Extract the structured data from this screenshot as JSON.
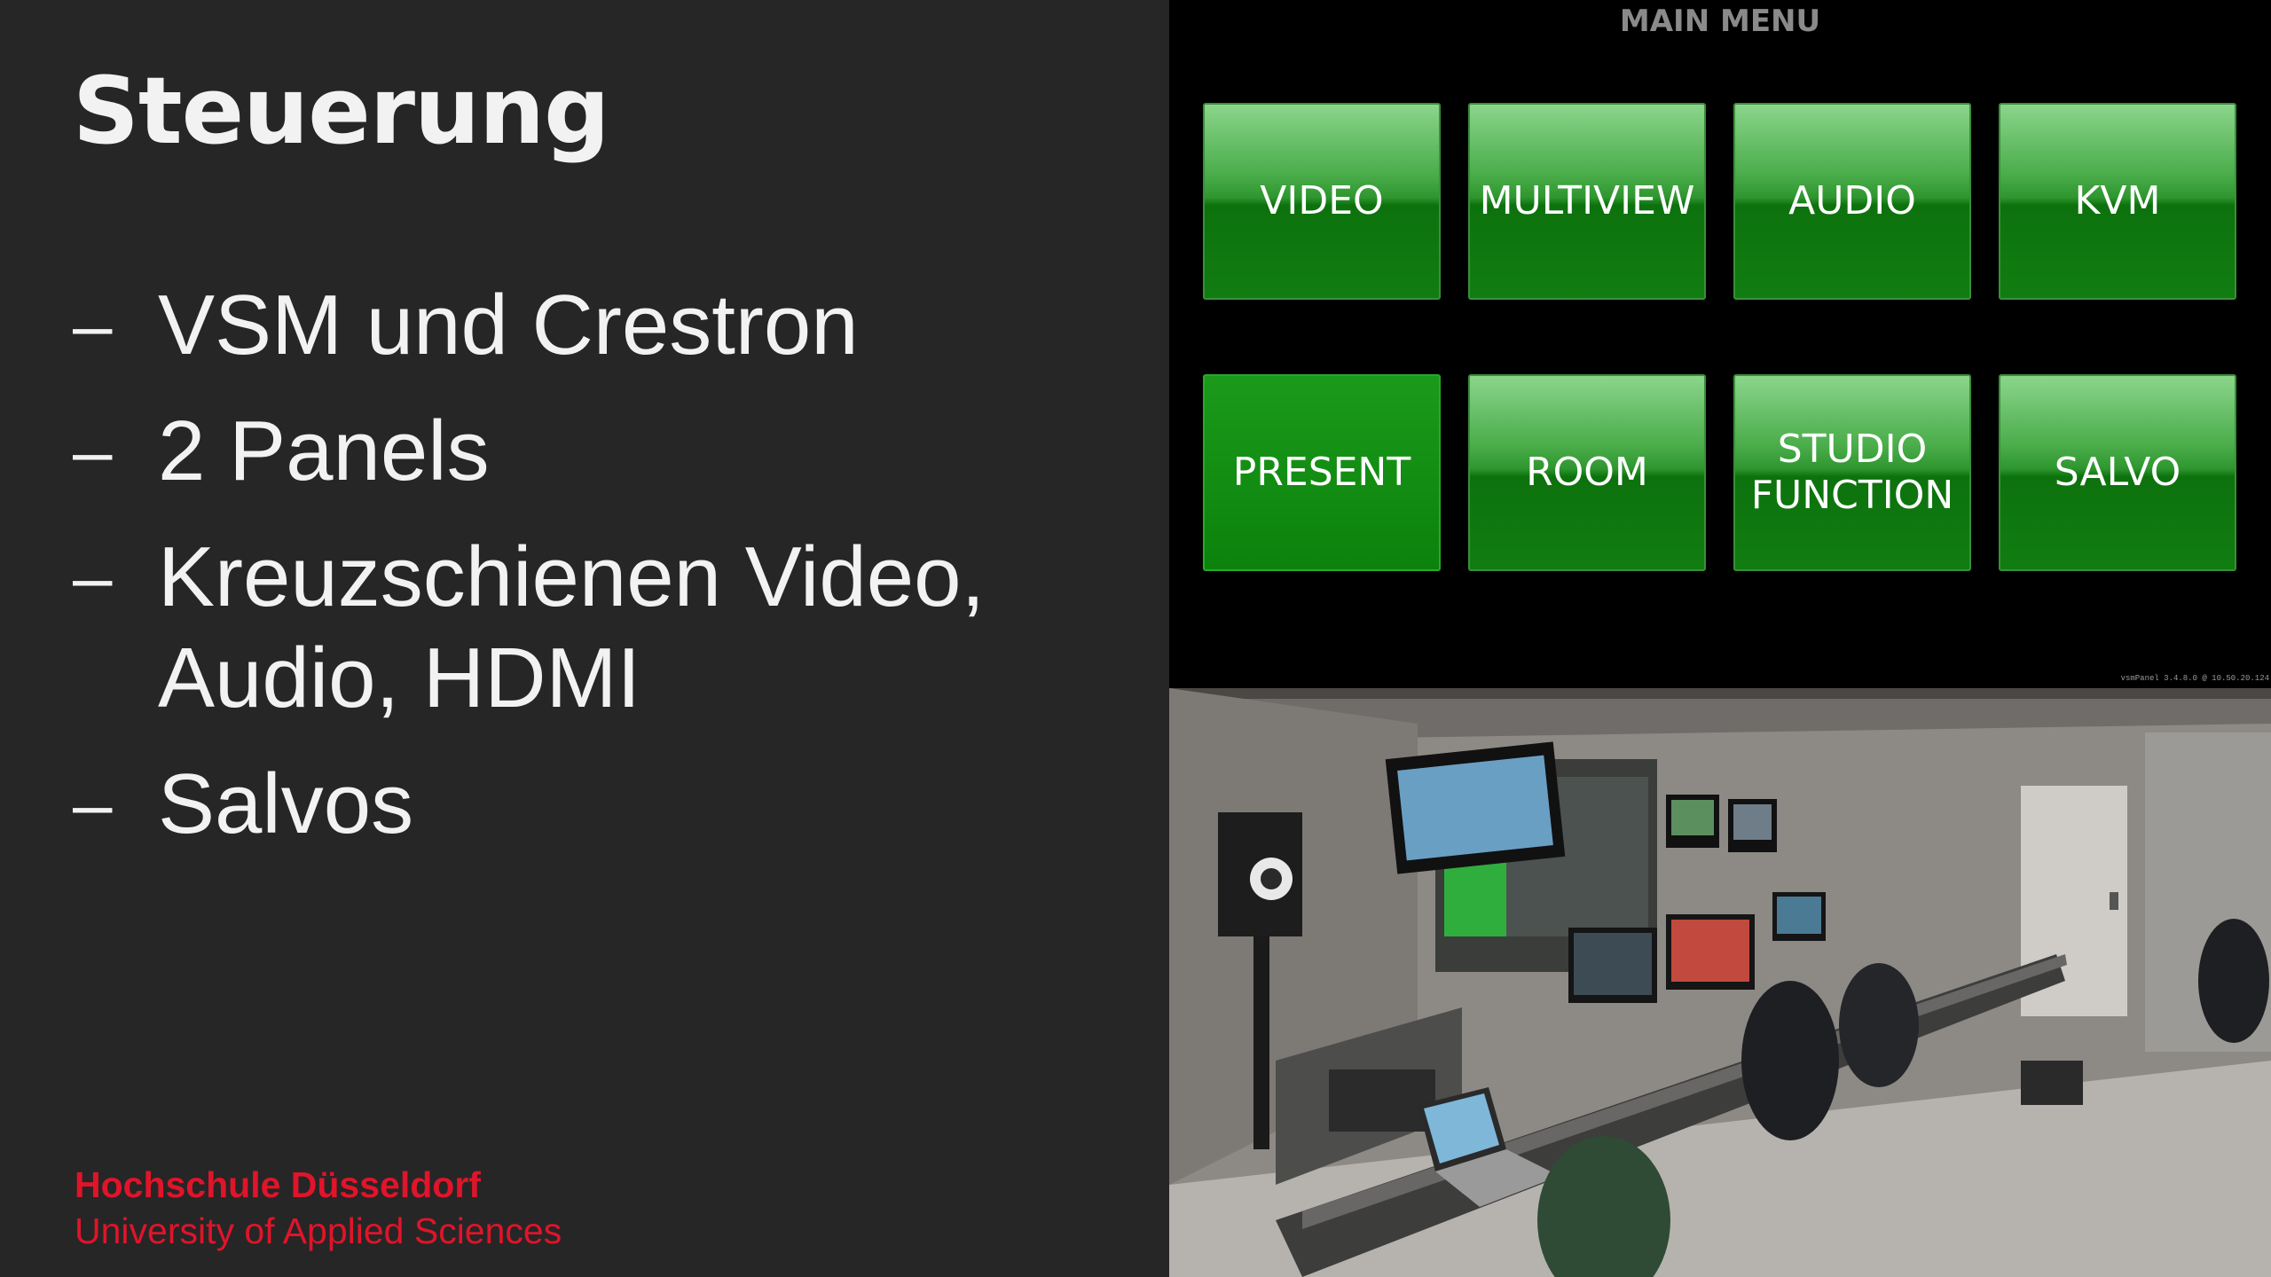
{
  "slide": {
    "title": "Steuerung",
    "bullets": [
      {
        "dash": "–",
        "text": "VSM und Crestron"
      },
      {
        "dash": "–",
        "text": "2 Panels"
      },
      {
        "dash": "–",
        "text": "Kreuzschienen Video, Audio, HDMI"
      },
      {
        "dash": "–",
        "text": "Salvos"
      }
    ],
    "footer": {
      "name": "Hochschule Düsseldorf",
      "subtitle": "University of Applied Sciences"
    }
  },
  "panel": {
    "title": "MAIN MENU",
    "buttons": [
      {
        "label": "VIDEO"
      },
      {
        "label": "MULTIVIEW"
      },
      {
        "label": "AUDIO"
      },
      {
        "label": "KVM"
      },
      {
        "label": "PRESENT"
      },
      {
        "label": "ROOM"
      },
      {
        "label": "STUDIO\nFUNCTION"
      },
      {
        "label": "SALVO"
      }
    ],
    "version": "vsmPanel 3.4.8.0 @ 10.50.20.124"
  },
  "colors": {
    "background": "#262626",
    "accent_red": "#e0142a",
    "button_green": "#1a8c1a"
  }
}
